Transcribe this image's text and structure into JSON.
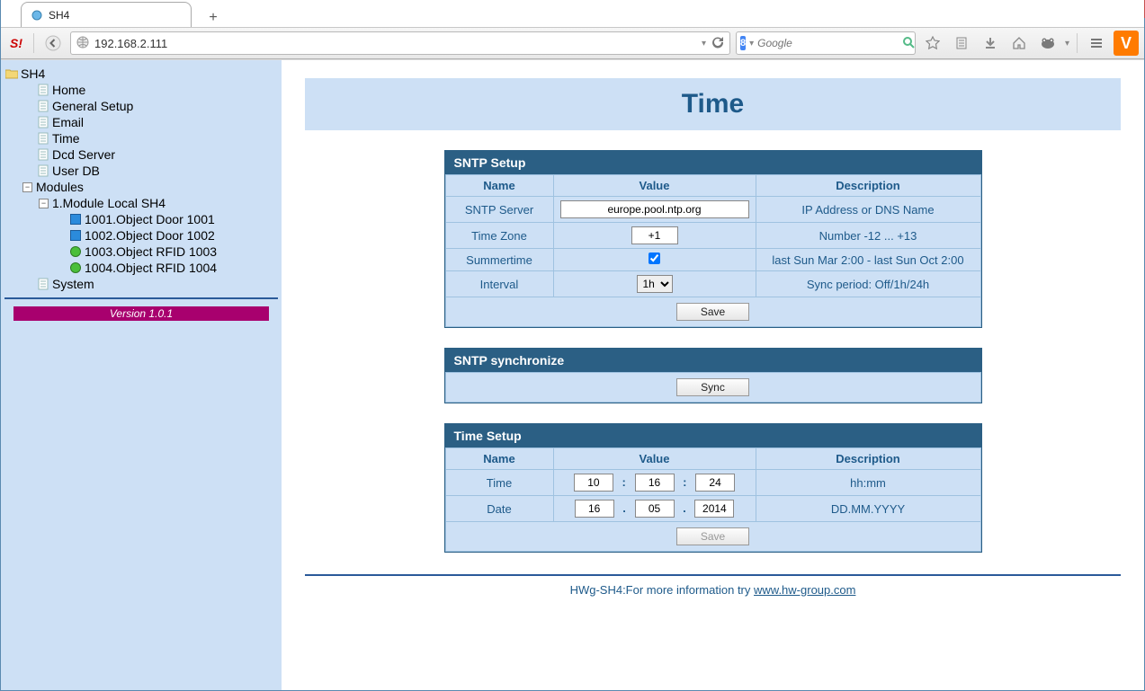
{
  "window": {
    "tab_title": "SH4"
  },
  "toolbar": {
    "url": "192.168.2.111",
    "search_placeholder": "Google"
  },
  "sidebar": {
    "root": "SH4",
    "items": [
      {
        "label": "Home"
      },
      {
        "label": "General Setup"
      },
      {
        "label": "Email"
      },
      {
        "label": "Time"
      },
      {
        "label": "Dcd Server"
      },
      {
        "label": "User DB"
      }
    ],
    "modules_label": "Modules",
    "module_group": "1.Module Local SH4",
    "module_children": [
      {
        "label": "1001.Object Door 1001",
        "kind": "door"
      },
      {
        "label": "1002.Object Door 1002",
        "kind": "door"
      },
      {
        "label": "1003.Object RFID 1003",
        "kind": "rfid"
      },
      {
        "label": "1004.Object RFID 1004",
        "kind": "rfid"
      }
    ],
    "system_label": "System",
    "version": "Version 1.0.1"
  },
  "page": {
    "title": "Time"
  },
  "sntp_setup": {
    "heading": "SNTP Setup",
    "col_name": "Name",
    "col_value": "Value",
    "col_desc": "Description",
    "rows": {
      "server": {
        "name": "SNTP Server",
        "value": "europe.pool.ntp.org",
        "desc": "IP Address or DNS Name"
      },
      "tz": {
        "name": "Time Zone",
        "value": "+1",
        "desc": "Number -12 ... +13"
      },
      "summer": {
        "name": "Summertime",
        "checked": true,
        "desc": "last Sun Mar 2:00 - last Sun Oct 2:00"
      },
      "interval": {
        "name": "Interval",
        "value": "1h",
        "desc": "Sync period: Off/1h/24h"
      }
    },
    "save_label": "Save"
  },
  "sntp_sync": {
    "heading": "SNTP synchronize",
    "sync_label": "Sync"
  },
  "time_setup": {
    "heading": "Time Setup",
    "col_name": "Name",
    "col_value": "Value",
    "col_desc": "Description",
    "time_row": {
      "name": "Time",
      "hh": "10",
      "mm": "16",
      "ss": "24",
      "desc": "hh:mm"
    },
    "date_row": {
      "name": "Date",
      "dd": "16",
      "mo": "05",
      "yy": "2014",
      "desc": "DD.MM.YYYY"
    },
    "save_label": "Save"
  },
  "footer": {
    "prefix": "HWg-SH4:For more information try ",
    "link_text": "www.hw-group.com"
  }
}
